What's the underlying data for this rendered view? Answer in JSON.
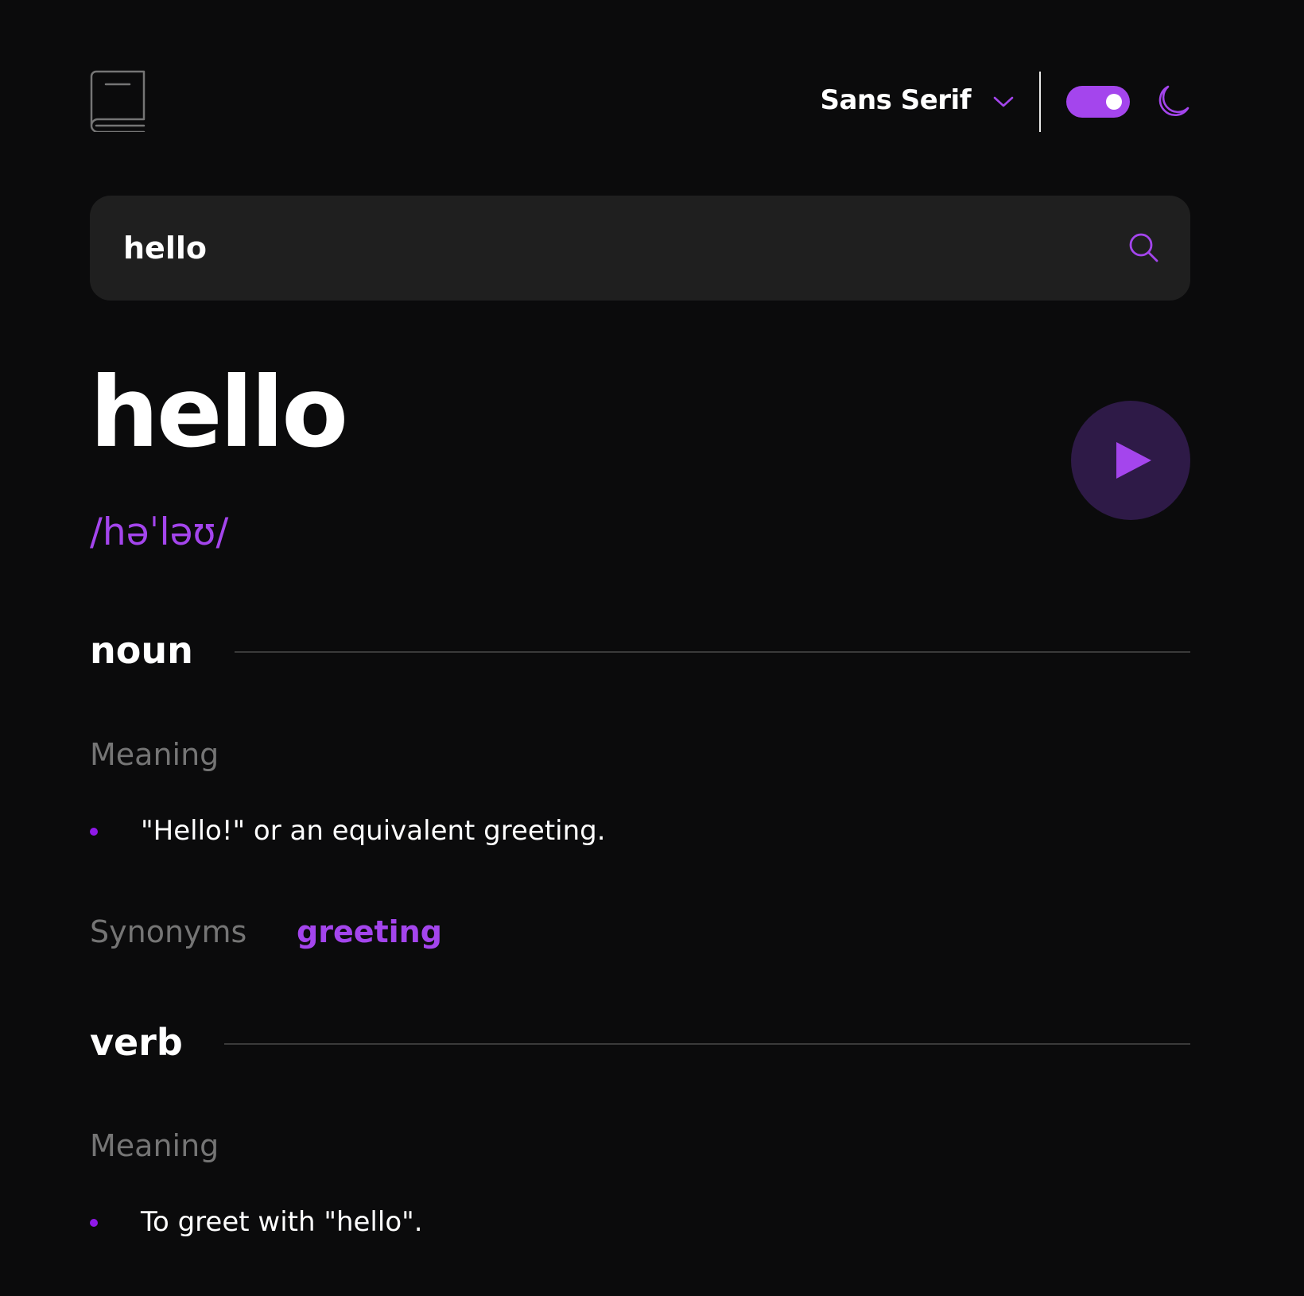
{
  "header": {
    "font_select": {
      "selected": "Sans Serif"
    },
    "theme_toggle": {
      "state": "dark"
    }
  },
  "search": {
    "value": "hello",
    "placeholder": ""
  },
  "entry": {
    "word": "hello",
    "phonetic": "/həˈləʊ/",
    "meanings": [
      {
        "part_of_speech": "noun",
        "heading": "Meaning",
        "definitions": [
          "\"Hello!\" or an equivalent greeting."
        ],
        "synonyms_label": "Synonyms",
        "synonyms": [
          "greeting"
        ]
      },
      {
        "part_of_speech": "verb",
        "heading": "Meaning",
        "definitions": [
          "To greet with \"hello\"."
        ]
      }
    ]
  },
  "colors": {
    "background": "#0b0b0c",
    "accent": "#a445ed",
    "search_bg": "#1f1f1f",
    "play_bg": "#2e1a47",
    "muted_text": "#757575",
    "divider": "#3a3a3a"
  },
  "icons": {
    "logo": "book-icon",
    "dropdown": "chevron-down-icon",
    "theme": "moon-icon",
    "search": "search-icon",
    "play": "play-icon"
  }
}
